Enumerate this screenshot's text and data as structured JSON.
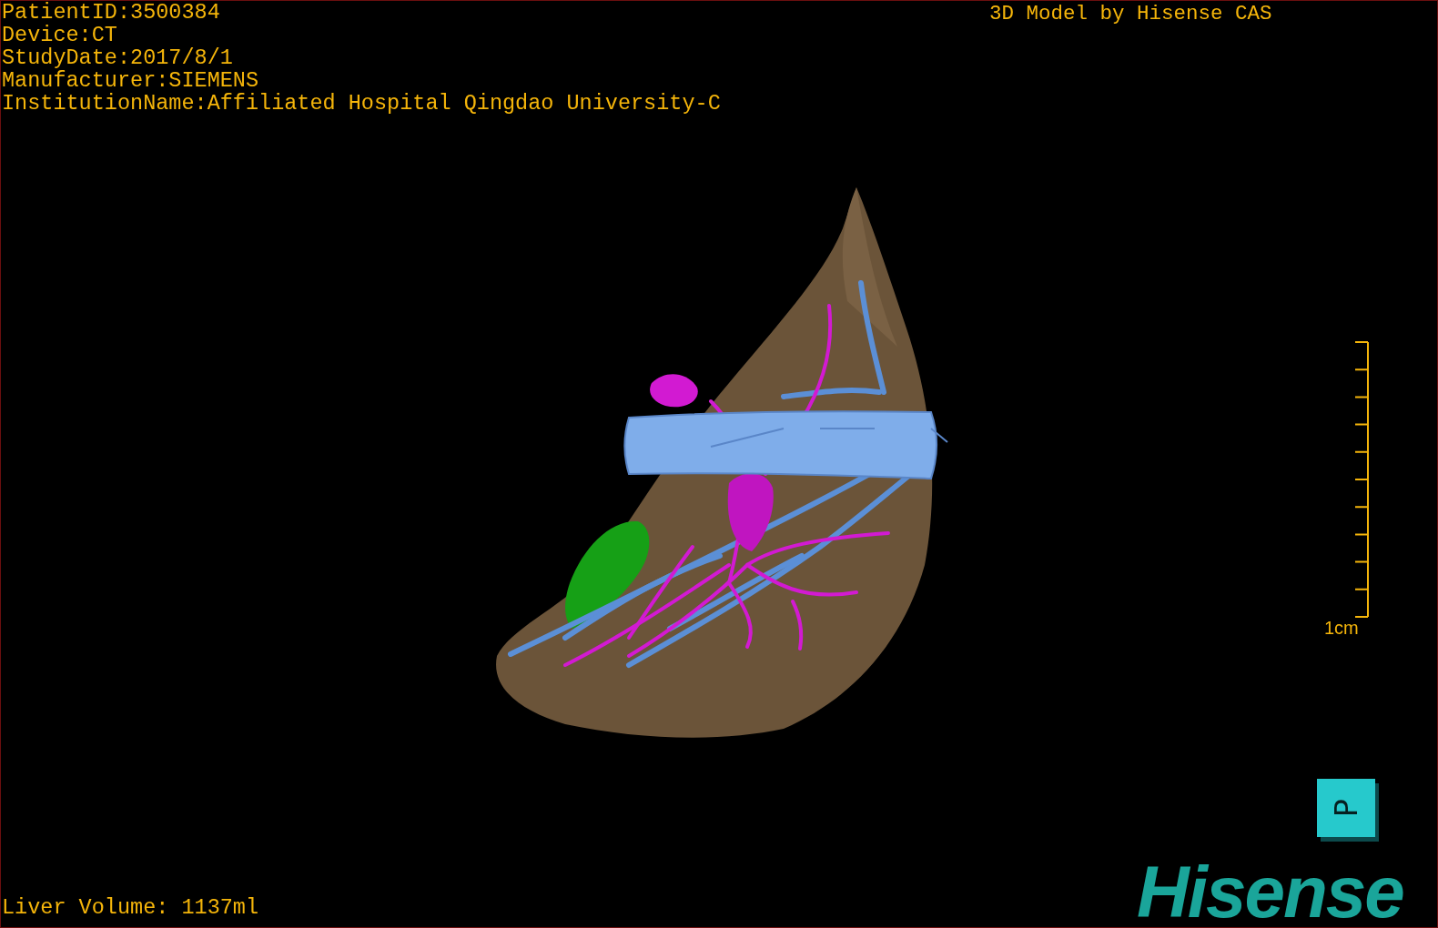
{
  "study_info": [
    "PatientID:3500384",
    "Device:CT",
    "StudyDate:2017/8/1",
    "Manufacturer:SIEMENS",
    "InstitutionName:Affiliated Hospital Qingdao University-C"
  ],
  "credit": "3D Model by Hisense CAS",
  "scale_bar": {
    "label": "1cm"
  },
  "orientation_cube": {
    "face_label": "P"
  },
  "logo": "Hisense",
  "measurement": "Liver Volume: 1137ml"
}
